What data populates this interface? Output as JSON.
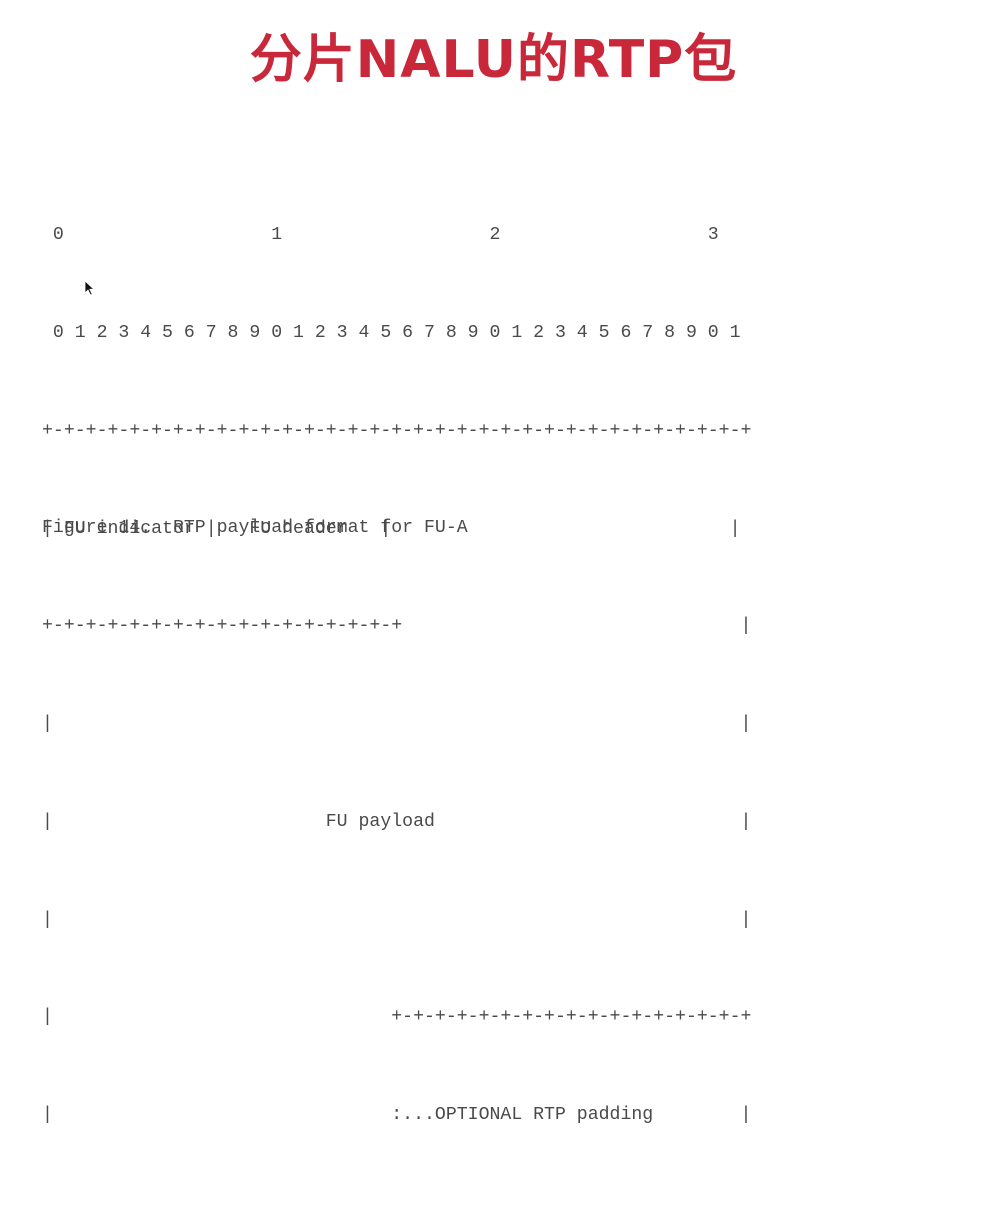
{
  "title": "分片NALU的RTP包",
  "diagram": {
    "lines": [
      " 0                   1                   2                   3",
      " 0 1 2 3 4 5 6 7 8 9 0 1 2 3 4 5 6 7 8 9 0 1 2 3 4 5 6 7 8 9 0 1",
      "+-+-+-+-+-+-+-+-+-+-+-+-+-+-+-+-+-+-+-+-+-+-+-+-+-+-+-+-+-+-+-+-+",
      "| FU indicator |   FU header   |                               |",
      "+-+-+-+-+-+-+-+-+-+-+-+-+-+-+-+-+                               |",
      "|                                                               |",
      "|                         FU payload                            |",
      "|                                                               |",
      "|                               +-+-+-+-+-+-+-+-+-+-+-+-+-+-+-+-+",
      "|                               :...OPTIONAL RTP padding        |",
      "+-+-+-+-+-+-+-+-+-+-+-+-+-+-+-+-+-+-+-+-+-+-+-+-+-+-+-+-+-+-+-+-+"
    ]
  },
  "caption": "Figure 14.  RTP payload format for FU-A",
  "colors": {
    "title": "#c8283a",
    "text": "#4a4a4a",
    "background": "#ffffff"
  },
  "icons": {
    "cursor": "mouse-pointer-icon"
  }
}
